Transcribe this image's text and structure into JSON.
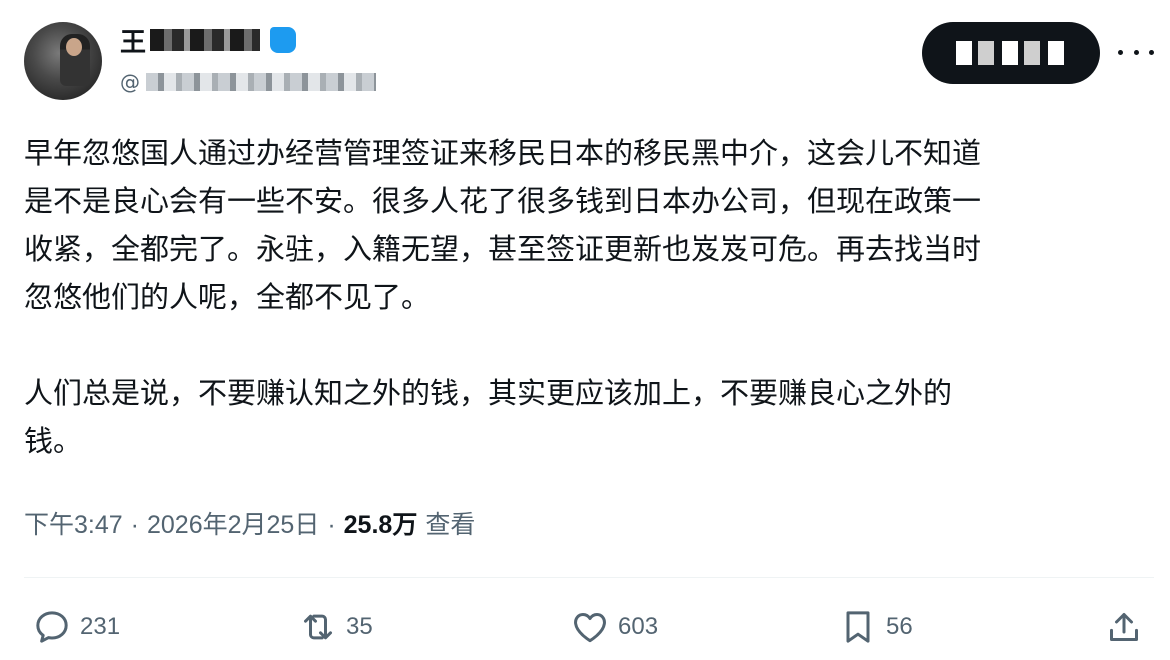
{
  "author": {
    "name_visible": "王",
    "handle_prefix": "@"
  },
  "post": {
    "paragraph_1": "早年忽悠国人通过办经营管理签证来移民日本的移民黑中介，这会儿不知道\n是不是良心会有一些不安。很多人花了很多钱到日本办公司，但现在政策一\n收紧，全都完了。永驻，入籍无望，甚至签证更新也岌岌可危。再去找当时\n忽悠他们的人呢，全都不见了。",
    "paragraph_2": "人们总是说，不要赚认知之外的钱，其实更应该加上，不要赚良心之外的\n钱。"
  },
  "meta": {
    "time": "下午3:47",
    "date": "2026年2月25日",
    "separator": "·",
    "views_count": "25.8万",
    "views_label": "查看"
  },
  "actions": {
    "replies": "231",
    "reposts": "35",
    "likes": "603",
    "bookmarks": "56"
  },
  "colors": {
    "text_primary": "#0f1419",
    "text_secondary": "#536471",
    "verified_accent": "#1d9bf0",
    "divider": "#eff3f4"
  },
  "icons": [
    "more-icon",
    "verified-icon",
    "reply-icon",
    "retweet-icon",
    "like-icon",
    "bookmark-icon",
    "share-icon"
  ]
}
